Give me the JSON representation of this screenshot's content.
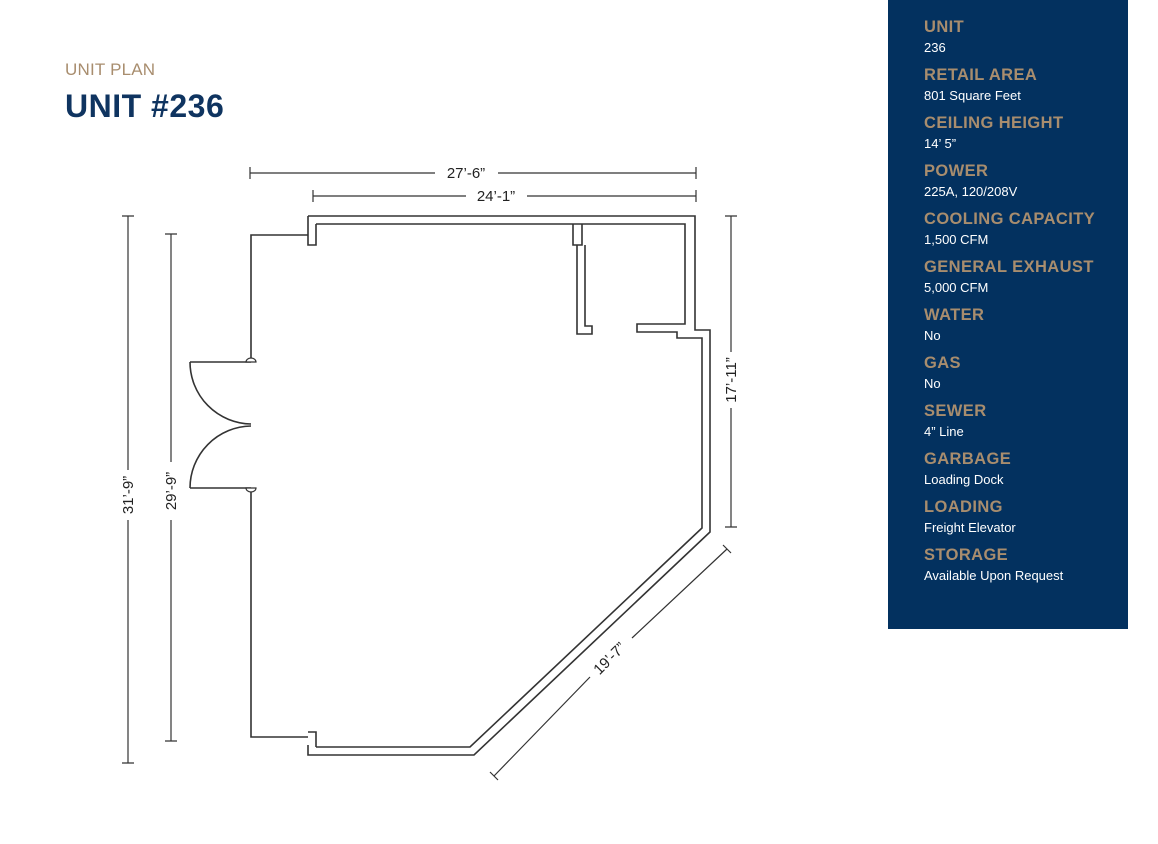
{
  "header": {
    "eyebrow": "UNIT PLAN",
    "title_prefix": "UNIT",
    "title_number": "#236"
  },
  "plan": {
    "dimensions": {
      "top_outer": "27’-6”",
      "top_inner": "24’-1”",
      "left_outer": "31’-9”",
      "left_inner": "29’-9”",
      "right": "17’-11”",
      "diagonal": "19’-7”"
    }
  },
  "specs": [
    {
      "label": "UNIT",
      "value": "236"
    },
    {
      "label": "RETAIL AREA",
      "value": "801 Square Feet"
    },
    {
      "label": "CEILING HEIGHT",
      "value": "14’ 5”"
    },
    {
      "label": "POWER",
      "value": "225A, 120/208V"
    },
    {
      "label": "COOLING CAPACITY",
      "value": "1,500 CFM"
    },
    {
      "label": "GENERAL EXHAUST",
      "value": "5,000 CFM"
    },
    {
      "label": "WATER",
      "value": "No"
    },
    {
      "label": "GAS",
      "value": "No"
    },
    {
      "label": "SEWER",
      "value": "4” Line"
    },
    {
      "label": "GARBAGE",
      "value": "Loading Dock"
    },
    {
      "label": "LOADING",
      "value": "Freight Elevator"
    },
    {
      "label": "STORAGE",
      "value": "Available Upon Request"
    }
  ],
  "colors": {
    "navy": "#03315f",
    "title_navy": "#0f3460",
    "tan": "#a88d6e"
  }
}
